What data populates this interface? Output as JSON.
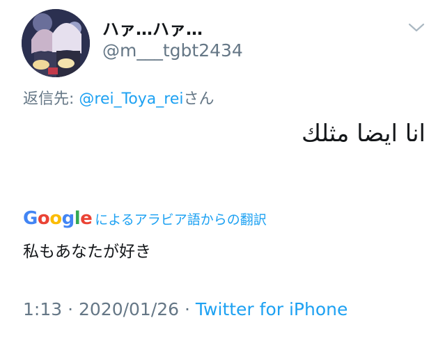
{
  "tweet": {
    "display_name": "ハァ…ハァ…",
    "handle": "@m___tgbt2434",
    "reply_prefix": "返信先: ",
    "reply_mention": "@rei_Toya_rei",
    "reply_suffix": "さん",
    "text": "انا ايضا مثلك",
    "translation": {
      "provider_letters": [
        "G",
        "o",
        "o",
        "g",
        "l",
        "e"
      ],
      "provider_colors": [
        "#4285F4",
        "#EA4335",
        "#FBBC05",
        "#4285F4",
        "#34A853",
        "#EA4335"
      ],
      "label": "によるアラビア語からの翻訳",
      "text": "私もあなたが好き"
    },
    "time": "1:13",
    "separator": " · ",
    "date": "2020/01/26",
    "source": "Twitter for iPhone"
  },
  "icons": {
    "menu": "chevron-down-icon",
    "avatar": "avatar"
  },
  "colors": {
    "link": "#1da1f2",
    "muted": "#657786",
    "text": "#14171a"
  }
}
